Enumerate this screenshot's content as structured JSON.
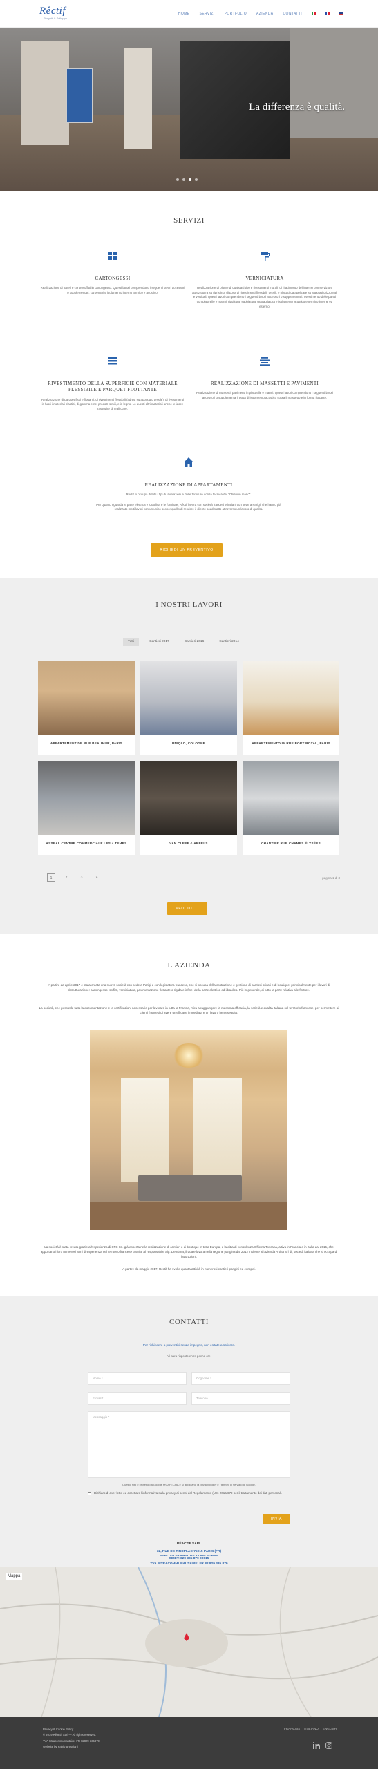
{
  "header": {
    "logo_text": "Rêctif",
    "logo_tagline": "Progetti & Sviluppo",
    "nav": [
      "HOME",
      "SERVIZI",
      "PORTFOLIO",
      "AZIENDA",
      "CONTATTI"
    ],
    "flags": [
      "IT",
      "FR",
      "EN"
    ]
  },
  "hero": {
    "headline": "La differenza è qualità.",
    "slide_count": 4,
    "active_slide": 3
  },
  "services": {
    "title": "SERVIZI",
    "items": [
      {
        "icon": "grid-icon",
        "title": "CARTONGESSI",
        "text": "Realizzazione di pareti e controsoffitti in cartongesso. Questi lavori comprendono i seguenti lavori accessori o supplementari: carpenteria, isolamento interno termico e acustico."
      },
      {
        "icon": "paint-roller-icon",
        "title": "VERNICIATURA",
        "text": "Realizzazione di pitture di qualsiasi tipo e rivestimenti murali, di rifacimento dell'interno con servizio e attrezzatura su ripristino, di posa di rivestimenti flessibili, tessili, e plastici da applicare su supporti orizzontali e verticali. Questi lavori comprendono i seguenti lavori accessori o supplementari: rivestimento delle pareti con piastrelle e marmi, ripulitura, sabbiatura, gravagliatura e isolamento acustico e termico interne ed esterno."
      },
      {
        "icon": "layers-icon",
        "title": "RIVESTIMENTO DELLA SUPERFICIE CON MATERIALE FLESSIBILE E PARQUET FLOTTANTE",
        "text": "Realizzazione di parquet fissi e flottanti, di rivestimenti flessibili (ad es. su appoggio tessile), di rivestimenti in fuori i materiali plastici, di gomma e nei prodotti simili, e in legno. Lo questi altri materiali anche le idoee rassodite di realizzare."
      },
      {
        "icon": "lines-icon",
        "title": "REALIZZAZIONE DI MASSETTI E PAVIMENTI",
        "text": "Realizzazione di massetti, pavimenti in piastrelle e marmi. Questi lavori comprendono i seguenti lavori accessori o supplementari: posa di isolamento acustico sopra il massetto e in forma flottante."
      },
      {
        "icon": "home-icon",
        "title": "REALIZZAZIONE DI APPARTAMENTI",
        "text": "Rêctif si occupa di tutti i tipi di lavorazioni e delle forniture con la tecnica del \"Chiavi in mano\".",
        "text2": "Per quanto riguarda le parte elettrica e idraulica e le forniture, Rêctif lavora con società francesi e italiani con sede a Parigi, che hanno già realizzato molti lavori con un unico scopo: quello di rendere il cliente soddisfatto attraverso un lavoro di qualità."
      }
    ],
    "cta": "RICHIEDI UN PREVENTIVO"
  },
  "works": {
    "title": "I NOSTRI LAVORI",
    "filters": [
      "Tutti",
      "Cantieri 2017",
      "Cantieri 2016",
      "Cantieri 2014"
    ],
    "active_filter": 0,
    "cards": [
      {
        "caption": "APPARTEMENT DE RUE BEAUMUR, PARIS"
      },
      {
        "caption": "UNIQLO, COLOGNE"
      },
      {
        "caption": "APPARTEMENTO IN RUE PORT ROYAL, PARIS"
      },
      {
        "caption": "ASSEAL CENTRE COMMERCIALE LES 4 TEMPS"
      },
      {
        "caption": "VAN CLEEF & ARPELS"
      },
      {
        "caption": "CHANTIER RUE CHAMPS ÉLYSÉES"
      }
    ],
    "pages": [
      "1",
      "2",
      "3",
      "»"
    ],
    "page_info": "pagina 1 di 3",
    "cta": "VEDI TUTTI"
  },
  "company": {
    "title": "L'AZIENDA",
    "p1": "A partire da aprile 2017 è stata creata una nuova società con sede a Parigi e con legislatura francese, che si occupa della costruzione e gestione di cantieri privati e di boutique, principalmente per i lavori di ristrutturazione: cartongesso, soffitti, verniciatura, pavimentazione flottante o rigida e infine, della parte elettrica ed idraulica. Più in generale, di tutto la parte relativa alle finiture.",
    "p2": "La società, che possiede tutta la documentazione e le certificazioni necessarie per lavorare in tutta la Francia, mira a raggiungere la massima efficacia, la serietà e qualità italiana sul territorio francese, per permettere ai clienti francesi di avere un'efficace immediata e un lavoro ben eseguito.",
    "p3": "La società è stata creata grazie all'esperienza di STC Srl. già esperta nella realizzazione di cantieri e di boutique in tutta Europa, e la ditta di consulenza Officina Toscana, attiva in Francia e in Italia dal 2015, che apportano i loro numerosi anni di esperienza nel territorio francese tramite al responsabile Sig. Demiana, il quale lavora nella regione parigina dal 2012 insieme all'azienda Artina Srl di, società italiana che si occupa di lavorazioni.",
    "p4": "A partire da maggio 2017, Rêctif ha svolto quanta attività in numerosi cantieri parigini ed europei."
  },
  "contacts": {
    "title": "CONTATTI",
    "intro": "Per richiedere a preventivi senza impegno, non esitate a scrivere.",
    "intro2": "Vi sarà risposto entro poche ore",
    "fields": {
      "name": "Nome *",
      "surname": "Cognome *",
      "email": "E-mail *",
      "phone": "Telefono",
      "message": "Messaggio *"
    },
    "consent": "Questo sito è protetto da Google reCAPTCHA e si applicano la privacy policy e i termini di servizio di Google.",
    "checkbox": "Dichiaro di aver letto ed accettare l'informativa sulla privacy ai sensi del Regolamento (UE) 2016/679 per il trattamento dei dati personali.",
    "submit": "INVIA",
    "company_name": "RÊACTIF SARL",
    "address": [
      "32, RUE DE TIROPLAC 75015 PARIS (FR)",
      "SARL AU CAPITAL DE 10 000 EUROS",
      "SIRET: 829 335 879 00015",
      "TVA INTRACOMMUNAUTAIRE: FR 82 829 335 879"
    ]
  },
  "map": {
    "label": "Mappa"
  },
  "footer": {
    "links": [
      "Privacy & Cookie Policy"
    ],
    "copyright": "© 2019 Rêactif Sarl — All rights reserved.",
    "vat": "TVA Intracommunautaire: FR 82829 335879",
    "credit": "Website by Fabio Bresciani",
    "langs": [
      "FRANÇAIS",
      "ITALIANO",
      "ENGLISH"
    ]
  }
}
